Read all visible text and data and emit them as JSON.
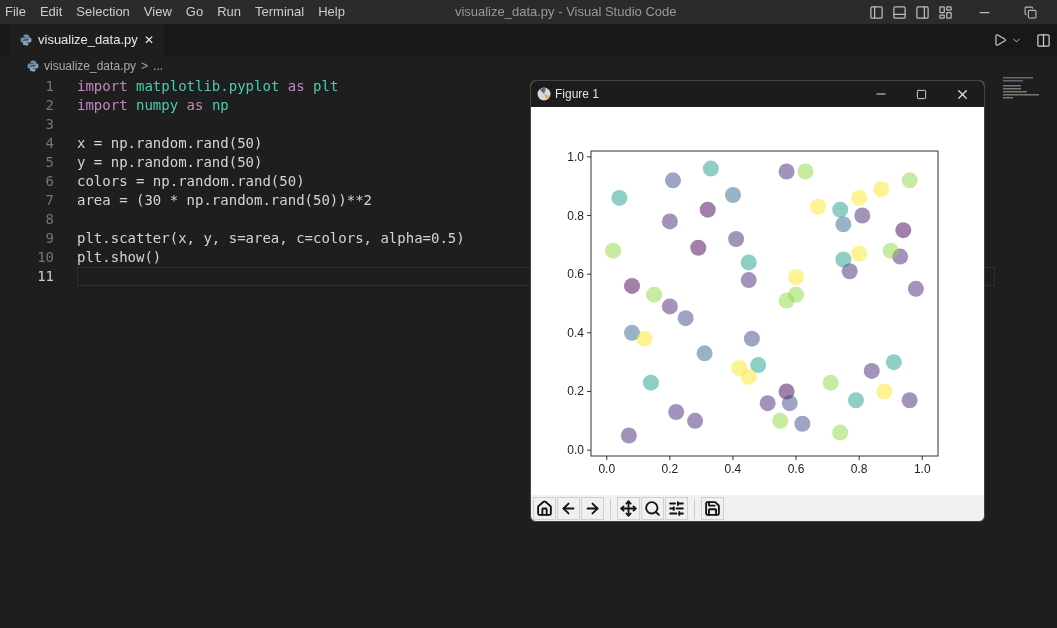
{
  "menu_bar": {
    "items": [
      "File",
      "Edit",
      "Selection",
      "View",
      "Go",
      "Run",
      "Terminal",
      "Help"
    ],
    "title": "visualize_data.py - Visual Studio Code"
  },
  "tabs": [
    {
      "label": "visualize_data.py",
      "selected": true,
      "close": "✕"
    }
  ],
  "breadcrumb": {
    "file": "visualize_data.py",
    "separator": ">",
    "rest": "..."
  },
  "editor": {
    "lines": [
      {
        "number": "1",
        "current": false,
        "tokens": [
          {
            "text": "import ",
            "kind": "keyword"
          },
          {
            "text": "matplotlib.pyplot ",
            "kind": "module"
          },
          {
            "text": "as ",
            "kind": "keyword"
          },
          {
            "text": "plt",
            "kind": "module"
          }
        ]
      },
      {
        "number": "2",
        "current": false,
        "tokens": [
          {
            "text": "import ",
            "kind": "keyword"
          },
          {
            "text": "numpy ",
            "kind": "module"
          },
          {
            "text": "as ",
            "kind": "keyword"
          },
          {
            "text": "np",
            "kind": "module"
          }
        ]
      },
      {
        "number": "3",
        "current": false
      },
      {
        "number": "4",
        "current": false,
        "tokens": [
          {
            "text": "x = np.random.rand(50)",
            "kind": "plain"
          }
        ]
      },
      {
        "number": "5",
        "current": false,
        "tokens": [
          {
            "text": "y = np.random.rand(50)",
            "kind": "plain"
          }
        ]
      },
      {
        "number": "6",
        "current": false,
        "tokens": [
          {
            "text": "colors = np.random.rand(50)",
            "kind": "plain"
          }
        ]
      },
      {
        "number": "7",
        "current": false,
        "tokens": [
          {
            "text": "area = (30 * np.random.rand(50))**2",
            "kind": "plain"
          }
        ]
      },
      {
        "number": "8",
        "current": false
      },
      {
        "number": "9",
        "current": false,
        "tokens": [
          {
            "text": "plt.scatter(x, y, s=area, c=colors, alpha=0.5)",
            "kind": "plain"
          }
        ]
      },
      {
        "number": "10",
        "current": false,
        "tokens": [
          {
            "text": "plt.show()",
            "kind": "plain"
          }
        ]
      },
      {
        "number": "11",
        "current": true
      }
    ]
  },
  "figure_window": {
    "title": "Figure 1",
    "chart_data": {
      "type": "scatter",
      "xlim": [
        -0.05,
        1.05
      ],
      "ylim": [
        -0.02,
        1.02
      ],
      "xticks": [
        {
          "value": 0,
          "label": "0.0"
        },
        {
          "value": 0.2,
          "label": "0.2"
        },
        {
          "value": 0.4,
          "label": "0.4"
        },
        {
          "value": 0.6,
          "label": "0.6"
        },
        {
          "value": 0.8,
          "label": "0.8"
        },
        {
          "value": 1,
          "label": "1.0"
        }
      ],
      "yticks": [
        {
          "value": 0,
          "label": "0.0"
        },
        {
          "value": 0.2,
          "label": "0.2"
        },
        {
          "value": 0.4,
          "label": "0.4"
        },
        {
          "value": 0.6,
          "label": "0.6"
        },
        {
          "value": 0.8,
          "label": "0.8"
        },
        {
          "value": 1,
          "label": "1.0"
        }
      ],
      "series": [
        {
          "color": "#440154",
          "x": [
            0.32,
            0.29,
            0.94,
            0.08,
            0.57
          ],
          "values": [
            0.82,
            0.69,
            0.75,
            0.56,
            0.2
          ]
        },
        {
          "color": "#482878",
          "x": [
            0.2,
            0.41,
            0.57,
            0.81,
            0.45,
            0.93,
            0.77,
            0.98,
            0.2,
            0.51,
            0.22,
            0.84,
            0.96,
            0.07,
            0.28
          ],
          "values": [
            0.78,
            0.72,
            0.95,
            0.8,
            0.58,
            0.66,
            0.61,
            0.55,
            0.49,
            0.16,
            0.13,
            0.27,
            0.17,
            0.05,
            0.1
          ]
        },
        {
          "color": "#3e4989",
          "x": [
            0.21,
            0.25,
            0.46,
            0.58,
            0.62
          ],
          "values": [
            0.92,
            0.45,
            0.38,
            0.16,
            0.09
          ]
        },
        {
          "color": "#31688e",
          "x": [
            0.4,
            0.75,
            0.08,
            0.31
          ],
          "values": [
            0.87,
            0.77,
            0.4,
            0.33
          ]
        },
        {
          "color": "#1f9e89",
          "x": [
            0.04,
            0.33,
            0.74,
            0.45,
            0.75,
            0.14,
            0.48,
            0.79,
            0.91
          ],
          "values": [
            0.86,
            0.96,
            0.82,
            0.64,
            0.65,
            0.23,
            0.29,
            0.17,
            0.3
          ]
        },
        {
          "color": "#90d743",
          "x": [
            0.63,
            0.96,
            0.02,
            0.9,
            0.57,
            0.6,
            0.15,
            0.55,
            0.71,
            0.74
          ],
          "values": [
            0.95,
            0.92,
            0.68,
            0.68,
            0.51,
            0.53,
            0.53,
            0.1,
            0.23,
            0.06
          ]
        },
        {
          "color": "#fde725",
          "x": [
            0.67,
            0.8,
            0.87,
            0.8,
            0.6,
            0.12,
            0.42,
            0.45,
            0.88
          ],
          "values": [
            0.83,
            0.86,
            0.89,
            0.67,
            0.59,
            0.38,
            0.28,
            0.25,
            0.2
          ]
        }
      ]
    }
  }
}
